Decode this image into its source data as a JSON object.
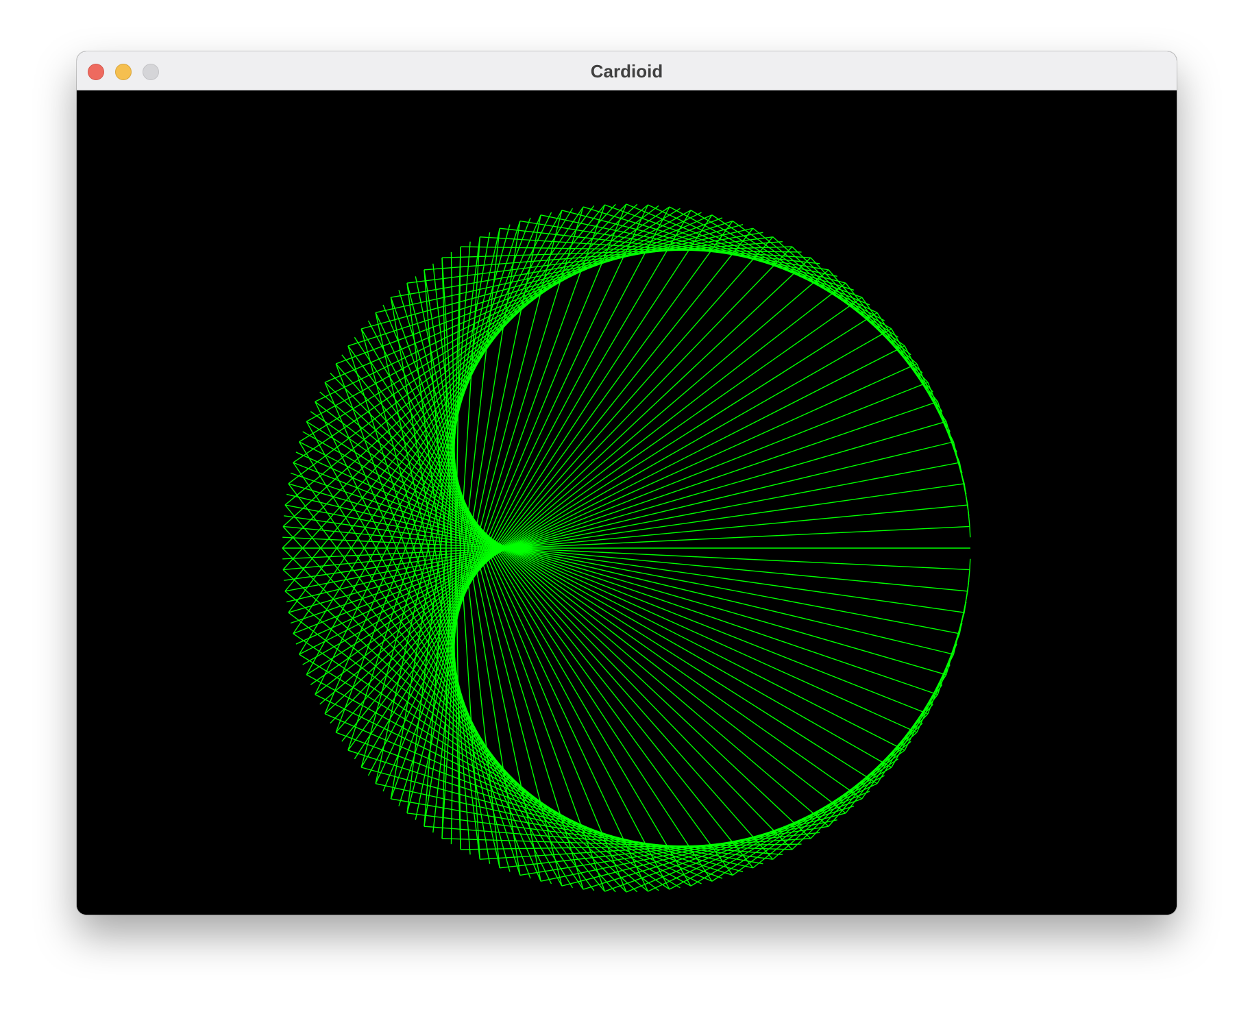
{
  "window": {
    "title": "Cardioid",
    "buttons": [
      "close-button",
      "minimize-button",
      "zoom-button"
    ]
  },
  "canvas": {
    "background": "#000000",
    "line_color": "#00ff00",
    "chord_count": 200,
    "multiplier": 2,
    "figure": "cardioid"
  }
}
